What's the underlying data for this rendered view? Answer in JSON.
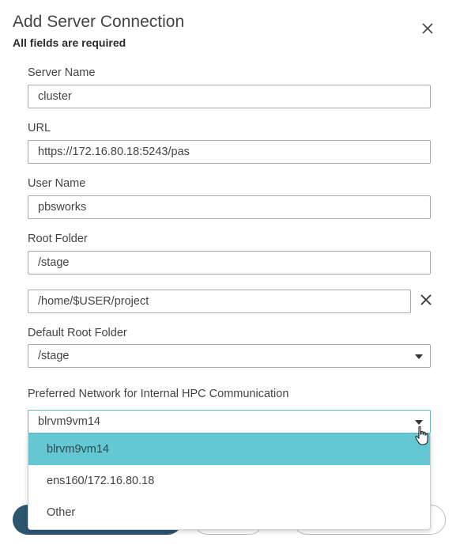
{
  "dialog": {
    "title": "Add Server Connection",
    "subtitle": "All fields are required"
  },
  "form": {
    "server_name": {
      "label": "Server Name",
      "value": "cluster"
    },
    "url": {
      "label": "URL",
      "value": "https://172.16.80.18:5243/pas"
    },
    "user_name": {
      "label": "User Name",
      "value": "pbsworks"
    },
    "root_folder": {
      "label": "Root Folder",
      "paths": [
        "/stage",
        "/home/$USER/project"
      ]
    },
    "default_root_folder": {
      "label": "Default Root Folder",
      "value": "/stage"
    },
    "preferred_network": {
      "label": "Preferred Network for Internal HPC Communication",
      "value": "blrvm9vm14",
      "options": [
        "blrvm9vm14",
        "ens160/172.16.80.18",
        "Other"
      ],
      "selected_index": 0
    }
  },
  "icons": {
    "close": "close-icon",
    "remove_path": "close-icon",
    "dropdown": "chevron-down-icon",
    "cursor": "hand-pointer-icon"
  },
  "colors": {
    "selected_option": "#64c7d1",
    "primary_button": "#2d5670",
    "active_border": "#5fb7c6"
  }
}
